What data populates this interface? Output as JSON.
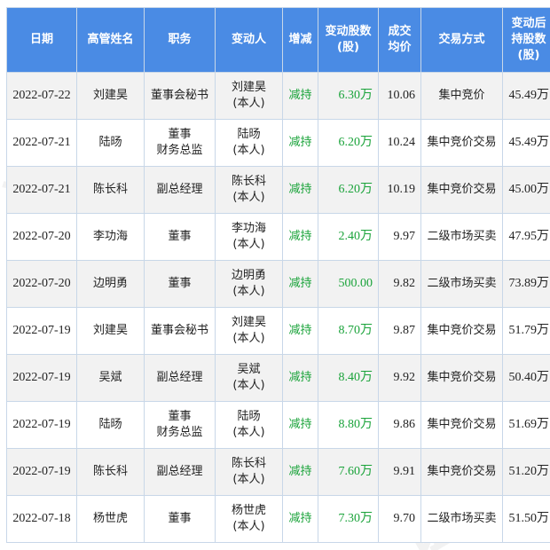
{
  "table": {
    "headers": [
      [
        "日期"
      ],
      [
        "高管姓名"
      ],
      [
        "职务"
      ],
      [
        "变动人"
      ],
      [
        "增减"
      ],
      [
        "变动股数",
        "(股)"
      ],
      [
        "成交",
        "均价"
      ],
      [
        "交易方式"
      ],
      [
        "变动后",
        "持股数",
        "(股)"
      ]
    ],
    "rows": [
      {
        "date": "2022-07-22",
        "name": "刘建昊",
        "position": [
          "董事会秘书"
        ],
        "changer": [
          "刘建昊",
          "(本人)"
        ],
        "direction": "减持",
        "shares": "6.30万",
        "price": "10.06",
        "method": "集中竞价",
        "holding": "45.49万"
      },
      {
        "date": "2022-07-21",
        "name": "陆旸",
        "position": [
          "董事",
          "财务总监"
        ],
        "changer": [
          "陆旸",
          "(本人)"
        ],
        "direction": "减持",
        "shares": "6.20万",
        "price": "10.24",
        "method": "集中竞价交易",
        "holding": "45.49万"
      },
      {
        "date": "2022-07-21",
        "name": "陈长科",
        "position": [
          "副总经理"
        ],
        "changer": [
          "陈长科",
          "(本人)"
        ],
        "direction": "减持",
        "shares": "6.20万",
        "price": "10.19",
        "method": "集中竞价交易",
        "holding": "45.00万"
      },
      {
        "date": "2022-07-20",
        "name": "李功海",
        "position": [
          "董事"
        ],
        "changer": [
          "李功海",
          "(本人)"
        ],
        "direction": "减持",
        "shares": "2.40万",
        "price": "9.97",
        "method": "二级市场买卖",
        "holding": "47.95万"
      },
      {
        "date": "2022-07-20",
        "name": "边明勇",
        "position": [
          "董事"
        ],
        "changer": [
          "边明勇",
          "(本人)"
        ],
        "direction": "减持",
        "shares": "500.00",
        "price": "9.82",
        "method": "二级市场买卖",
        "holding": "73.89万"
      },
      {
        "date": "2022-07-19",
        "name": "刘建昊",
        "position": [
          "董事会秘书"
        ],
        "changer": [
          "刘建昊",
          "(本人)"
        ],
        "direction": "减持",
        "shares": "8.70万",
        "price": "9.87",
        "method": "集中竞价交易",
        "holding": "51.79万"
      },
      {
        "date": "2022-07-19",
        "name": "吴斌",
        "position": [
          "副总经理"
        ],
        "changer": [
          "吴斌",
          "(本人)"
        ],
        "direction": "减持",
        "shares": "8.40万",
        "price": "9.92",
        "method": "集中竞价交易",
        "holding": "50.40万"
      },
      {
        "date": "2022-07-19",
        "name": "陆旸",
        "position": [
          "董事",
          "财务总监"
        ],
        "changer": [
          "陆旸",
          "(本人)"
        ],
        "direction": "减持",
        "shares": "8.80万",
        "price": "9.86",
        "method": "集中竞价交易",
        "holding": "51.69万"
      },
      {
        "date": "2022-07-19",
        "name": "陈长科",
        "position": [
          "副总经理"
        ],
        "changer": [
          "陈长科",
          "(本人)"
        ],
        "direction": "减持",
        "shares": "7.60万",
        "price": "9.91",
        "method": "集中竞价交易",
        "holding": "51.20万"
      },
      {
        "date": "2022-07-18",
        "name": "杨世虎",
        "position": [
          "董事"
        ],
        "changer": [
          "杨世虎",
          "(本人)"
        ],
        "direction": "减持",
        "shares": "7.30万",
        "price": "9.70",
        "method": "二级市场买卖",
        "holding": "51.50万"
      }
    ]
  },
  "watermark": {
    "text": "证券之星"
  }
}
